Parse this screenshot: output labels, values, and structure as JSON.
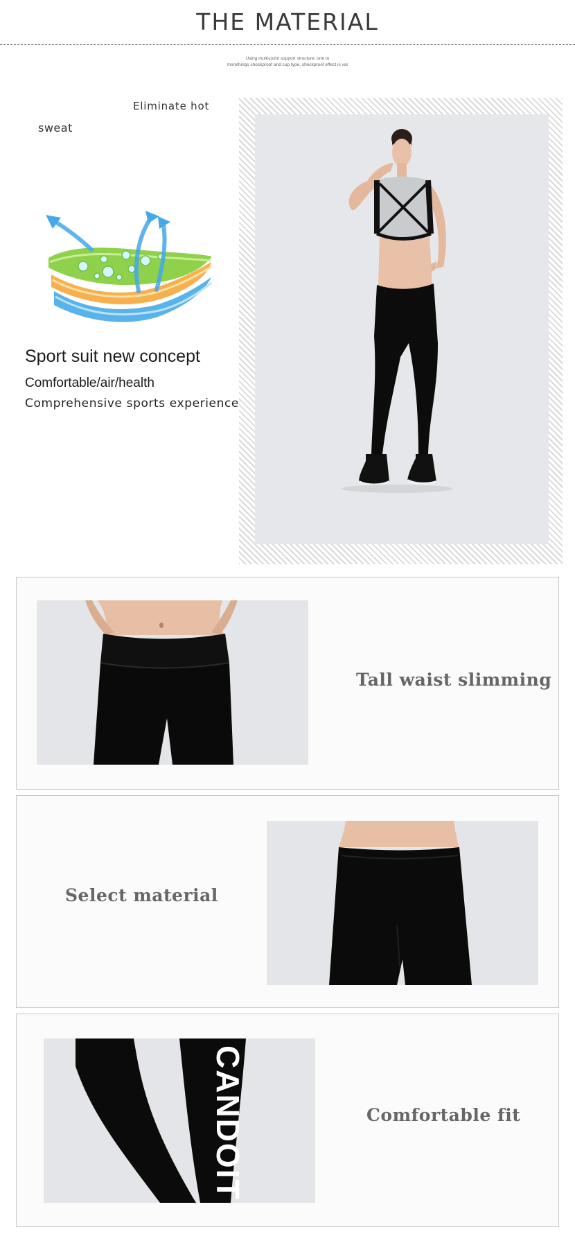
{
  "header": {
    "title": "THE MATERIAL",
    "subtitle_line1": "Using multi-point support structure, one to",
    "subtitle_line2": "morethings shockproof and cup type, shockproof effect is var"
  },
  "intro": {
    "graphic_label_hot": "Eliminate hot",
    "graphic_label_sweat": "sweat",
    "concept_title": "Sport suit new concept",
    "concept_line1": "Comfortable/air/health",
    "concept_line2": "Comprehensive sports experience"
  },
  "features": [
    {
      "caption": "Tall waist slimming"
    },
    {
      "caption": "Select material"
    },
    {
      "caption": "Comfortable fit"
    }
  ],
  "leg_print_text": "CANDOIT",
  "colors": {
    "title": "#3a3a3a",
    "caption": "#666666",
    "fabric_green": "#8fd14a",
    "fabric_orange": "#f6a73a",
    "fabric_blue": "#3ba6e6",
    "arrow_blue": "#45a8e8"
  }
}
